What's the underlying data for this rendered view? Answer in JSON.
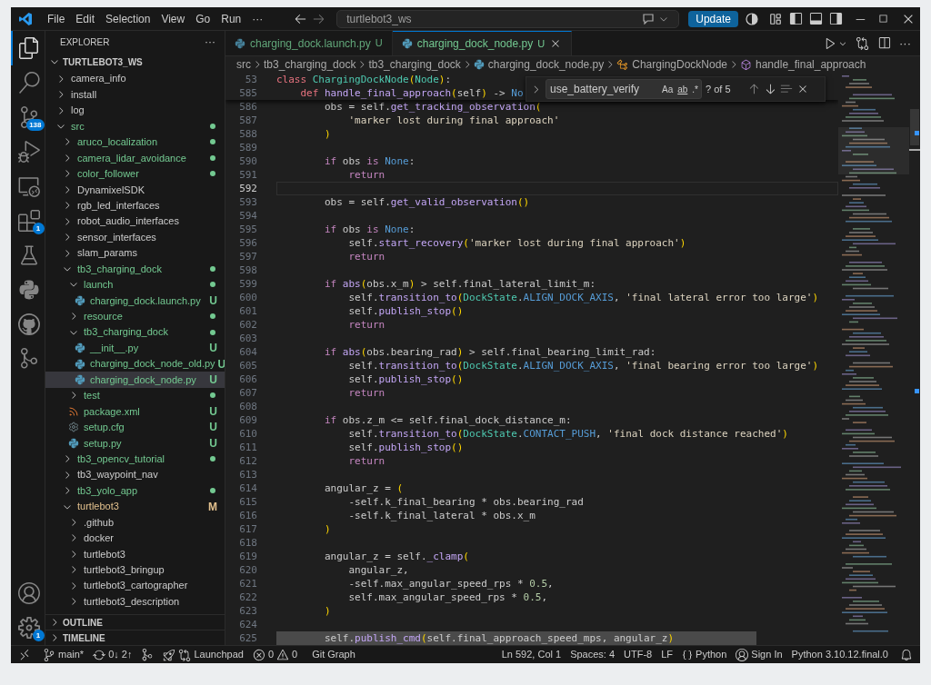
{
  "title_bar": {
    "menus": [
      "File",
      "Edit",
      "Selection",
      "View",
      "Go",
      "Run",
      "···"
    ],
    "command_center": "turtlebot3_ws",
    "update_button": "Update"
  },
  "activity_bar": {
    "items": [
      {
        "kind": "explorer",
        "selected": true
      },
      {
        "kind": "search",
        "selected": false
      },
      {
        "kind": "source_control",
        "selected": false,
        "badge": "138"
      },
      {
        "kind": "run_debug",
        "selected": false
      },
      {
        "kind": "remote",
        "selected": false
      },
      {
        "kind": "extensions",
        "selected": false,
        "badge": "1"
      },
      {
        "kind": "testing",
        "selected": false
      },
      {
        "kind": "python",
        "selected": false
      },
      {
        "kind": "github",
        "selected": false
      },
      {
        "kind": "git_graph",
        "selected": false
      }
    ],
    "bottom": [
      {
        "kind": "accounts"
      },
      {
        "kind": "settings",
        "badge": "1"
      }
    ]
  },
  "sidebar": {
    "title": "EXPLORER",
    "more": "···",
    "workspace": "TURTLEBOT3_WS",
    "tree": [
      {
        "label": "camera_info",
        "kind": "folder",
        "expanded": false,
        "color": "#cccccc",
        "dot": false,
        "selected": false
      },
      {
        "label": "install",
        "kind": "folder",
        "expanded": false,
        "color": "#cccccc",
        "dot": false,
        "selected": false
      },
      {
        "label": "log",
        "kind": "folder",
        "expanded": false,
        "color": "#cccccc",
        "dot": false,
        "selected": false
      },
      {
        "label": "src",
        "kind": "folder",
        "expanded": true,
        "color": "#73c991",
        "dot": true,
        "selected": false,
        "children": [
          {
            "label": "aruco_localization",
            "kind": "folder",
            "expanded": false,
            "color": "#73c991",
            "dot": true,
            "selected": false
          },
          {
            "label": "camera_lidar_avoidance",
            "kind": "folder",
            "expanded": false,
            "color": "#73c991",
            "dot": true,
            "selected": false
          },
          {
            "label": "color_follower",
            "kind": "folder",
            "expanded": false,
            "color": "#73c991",
            "dot": true,
            "selected": false
          },
          {
            "label": "DynamixelSDK",
            "kind": "folder",
            "expanded": false,
            "color": "#cccccc",
            "dot": false,
            "selected": false
          },
          {
            "label": "rgb_led_interfaces",
            "kind": "folder",
            "expanded": false,
            "color": "#cccccc",
            "dot": false,
            "selected": false
          },
          {
            "label": "robot_audio_interfaces",
            "kind": "folder",
            "expanded": false,
            "color": "#cccccc",
            "dot": false,
            "selected": false
          },
          {
            "label": "sensor_interfaces",
            "kind": "folder",
            "expanded": false,
            "color": "#cccccc",
            "dot": false,
            "selected": false
          },
          {
            "label": "slam_params",
            "kind": "folder",
            "expanded": false,
            "color": "#cccccc",
            "dot": false,
            "selected": false
          },
          {
            "label": "tb3_charging_dock",
            "kind": "folder",
            "expanded": true,
            "color": "#73c991",
            "dot": true,
            "selected": false,
            "children": [
              {
                "label": "launch",
                "kind": "folder",
                "expanded": true,
                "color": "#73c991",
                "dot": true,
                "selected": false,
                "children": [
                  {
                    "label": "charging_dock.launch.py",
                    "kind": "python",
                    "color": "#73c991",
                    "badge": "U",
                    "dot": false,
                    "selected": false
                  }
                ]
              },
              {
                "label": "resource",
                "kind": "folder",
                "expanded": false,
                "color": "#73c991",
                "dot": true,
                "selected": false
              },
              {
                "label": "tb3_charging_dock",
                "kind": "folder",
                "expanded": true,
                "color": "#73c991",
                "dot": true,
                "selected": false,
                "children": [
                  {
                    "label": "__init__.py",
                    "kind": "python",
                    "color": "#73c991",
                    "badge": "U",
                    "dot": false,
                    "selected": false
                  },
                  {
                    "label": "charging_dock_node_old.py",
                    "kind": "python",
                    "color": "#73c991",
                    "badge": "U",
                    "dot": false,
                    "selected": false
                  },
                  {
                    "label": "charging_dock_node.py",
                    "kind": "python",
                    "color": "#73c991",
                    "badge": "U",
                    "dot": false,
                    "selected": true
                  }
                ]
              },
              {
                "label": "test",
                "kind": "folder",
                "expanded": false,
                "color": "#73c991",
                "dot": true,
                "selected": false
              },
              {
                "label": "package.xml",
                "kind": "xml",
                "color": "#73c991",
                "badge": "U",
                "dot": false,
                "selected": false
              },
              {
                "label": "setup.cfg",
                "kind": "config",
                "color": "#73c991",
                "badge": "U",
                "dot": false,
                "selected": false
              },
              {
                "label": "setup.py",
                "kind": "python",
                "color": "#73c991",
                "badge": "U",
                "dot": false,
                "selected": false
              }
            ]
          },
          {
            "label": "tb3_opencv_tutorial",
            "kind": "folder",
            "expanded": false,
            "color": "#73c991",
            "dot": true,
            "selected": false
          },
          {
            "label": "tb3_waypoint_nav",
            "kind": "folder",
            "expanded": false,
            "color": "#cccccc",
            "dot": false,
            "selected": false
          },
          {
            "label": "tb3_yolo_app",
            "kind": "folder",
            "expanded": false,
            "color": "#73c991",
            "dot": true,
            "selected": false
          },
          {
            "label": "turtlebot3",
            "kind": "folder",
            "expanded": true,
            "color": "#e2c08d",
            "badge": "M",
            "dot": false,
            "selected": false,
            "children": [
              {
                "label": ".github",
                "kind": "folder",
                "expanded": false,
                "color": "#cccccc",
                "dot": false,
                "selected": false
              },
              {
                "label": "docker",
                "kind": "folder",
                "expanded": false,
                "color": "#cccccc",
                "dot": false,
                "selected": false
              },
              {
                "label": "turtlebot3",
                "kind": "folder",
                "expanded": false,
                "color": "#cccccc",
                "dot": false,
                "selected": false
              },
              {
                "label": "turtlebot3_bringup",
                "kind": "folder",
                "expanded": false,
                "color": "#cccccc",
                "dot": false,
                "selected": false
              },
              {
                "label": "turtlebot3_cartographer",
                "kind": "folder",
                "expanded": false,
                "color": "#cccccc",
                "dot": false,
                "selected": false
              },
              {
                "label": "turtlebot3_description",
                "kind": "folder",
                "expanded": false,
                "color": "#cccccc",
                "dot": false,
                "selected": false
              }
            ]
          }
        ]
      }
    ],
    "sections": [
      "OUTLINE",
      "TIMELINE"
    ]
  },
  "editor": {
    "tabs": [
      {
        "label": "charging_dock.launch.py",
        "badge": "U",
        "selected": false
      },
      {
        "label": "charging_dock_node.py",
        "badge": "U",
        "selected": true
      }
    ],
    "more": "···",
    "breadcrumbs": [
      {
        "kind": "folder",
        "label": "src"
      },
      {
        "kind": "folder",
        "label": "tb3_charging_dock"
      },
      {
        "kind": "folder",
        "label": "tb3_charging_dock"
      },
      {
        "kind": "python",
        "label": "charging_dock_node.py"
      },
      {
        "kind": "class",
        "label": "ChargingDockNode"
      },
      {
        "kind": "method",
        "label": "handle_final_approach"
      }
    ],
    "find": {
      "value": "use_battery_verify",
      "toggles": [
        "Aa",
        "ab",
        ".*"
      ],
      "result": "? of 5"
    },
    "sticky_lines": [
      {
        "number": "53",
        "tokens": [
          {
            "kind": "keyword",
            "text": "class "
          },
          {
            "kind": "class",
            "text": "ChargingDockNode"
          },
          {
            "kind": "bracket",
            "text": "("
          },
          {
            "kind": "class",
            "text": "Node"
          },
          {
            "kind": "bracket",
            "text": ")"
          },
          {
            "kind": "plain",
            "text": ":"
          }
        ]
      },
      {
        "number": "585",
        "tokens": [
          {
            "kind": "keyword",
            "text": "    def "
          },
          {
            "kind": "function",
            "text": "handle_final_approach"
          },
          {
            "kind": "bracket",
            "text": "("
          },
          {
            "kind": "plain",
            "text": "self"
          },
          {
            "kind": "bracket",
            "text": ")"
          },
          {
            "kind": "plain",
            "text": " -> "
          },
          {
            "kind": "constant",
            "text": "No"
          }
        ]
      }
    ],
    "lines": [
      {
        "number": "586",
        "current": false,
        "selected": false,
        "tokens": [
          {
            "kind": "plain",
            "text": "        obs = self."
          },
          {
            "kind": "function",
            "text": "get_tracking_observation"
          },
          {
            "kind": "bracket",
            "text": "("
          }
        ]
      },
      {
        "number": "587",
        "current": false,
        "selected": false,
        "tokens": [
          {
            "kind": "string",
            "text": "            'marker lost during final approach'"
          }
        ]
      },
      {
        "number": "588",
        "current": false,
        "selected": false,
        "tokens": [
          {
            "kind": "bracket",
            "text": "        )"
          }
        ]
      },
      {
        "number": "589",
        "current": false,
        "selected": false
      },
      {
        "number": "590",
        "current": false,
        "selected": false,
        "tokens": [
          {
            "kind": "control",
            "text": "        if"
          },
          {
            "kind": "plain",
            "text": " obs "
          },
          {
            "kind": "control",
            "text": "is"
          },
          {
            "kind": "constant",
            "text": " None"
          },
          {
            "kind": "plain",
            "text": ":"
          }
        ]
      },
      {
        "number": "591",
        "current": false,
        "selected": false,
        "tokens": [
          {
            "kind": "control",
            "text": "            return"
          }
        ]
      },
      {
        "number": "592",
        "current": true,
        "selected": false
      },
      {
        "number": "593",
        "current": false,
        "selected": false,
        "tokens": [
          {
            "kind": "plain",
            "text": "        obs = self."
          },
          {
            "kind": "function",
            "text": "get_valid_observation"
          },
          {
            "kind": "bracket",
            "text": "()"
          }
        ]
      },
      {
        "number": "594",
        "current": false,
        "selected": false
      },
      {
        "number": "595",
        "current": false,
        "selected": false,
        "tokens": [
          {
            "kind": "control",
            "text": "        if"
          },
          {
            "kind": "plain",
            "text": " obs "
          },
          {
            "kind": "control",
            "text": "is"
          },
          {
            "kind": "constant",
            "text": " None"
          },
          {
            "kind": "plain",
            "text": ":"
          }
        ]
      },
      {
        "number": "596",
        "current": false,
        "selected": false,
        "tokens": [
          {
            "kind": "plain",
            "text": "            self."
          },
          {
            "kind": "function",
            "text": "start_recovery"
          },
          {
            "kind": "bracket",
            "text": "("
          },
          {
            "kind": "string",
            "text": "'marker lost during final approach'"
          },
          {
            "kind": "bracket",
            "text": ")"
          }
        ]
      },
      {
        "number": "597",
        "current": false,
        "selected": false,
        "tokens": [
          {
            "kind": "control",
            "text": "            return"
          }
        ]
      },
      {
        "number": "598",
        "current": false,
        "selected": false
      },
      {
        "number": "599",
        "current": false,
        "selected": false,
        "tokens": [
          {
            "kind": "control",
            "text": "        if "
          },
          {
            "kind": "function",
            "text": "abs"
          },
          {
            "kind": "bracket",
            "text": "("
          },
          {
            "kind": "plain",
            "text": "obs.x_m"
          },
          {
            "kind": "bracket",
            "text": ")"
          },
          {
            "kind": "plain",
            "text": " > self.final_lateral_limit_m:"
          }
        ]
      },
      {
        "number": "600",
        "current": false,
        "selected": false,
        "tokens": [
          {
            "kind": "plain",
            "text": "            self."
          },
          {
            "kind": "function",
            "text": "transition_to"
          },
          {
            "kind": "bracket",
            "text": "("
          },
          {
            "kind": "class",
            "text": "DockState"
          },
          {
            "kind": "plain",
            "text": "."
          },
          {
            "kind": "constant",
            "text": "ALIGN_DOCK_AXIS"
          },
          {
            "kind": "plain",
            "text": ", "
          },
          {
            "kind": "string",
            "text": "'final lateral error too large'"
          },
          {
            "kind": "bracket",
            "text": ")"
          }
        ]
      },
      {
        "number": "601",
        "current": false,
        "selected": false,
        "tokens": [
          {
            "kind": "plain",
            "text": "            self."
          },
          {
            "kind": "function",
            "text": "publish_stop"
          },
          {
            "kind": "bracket",
            "text": "()"
          }
        ]
      },
      {
        "number": "602",
        "current": false,
        "selected": false,
        "tokens": [
          {
            "kind": "control",
            "text": "            return"
          }
        ]
      },
      {
        "number": "603",
        "current": false,
        "selected": false
      },
      {
        "number": "604",
        "current": false,
        "selected": false,
        "tokens": [
          {
            "kind": "control",
            "text": "        if "
          },
          {
            "kind": "function",
            "text": "abs"
          },
          {
            "kind": "bracket",
            "text": "("
          },
          {
            "kind": "plain",
            "text": "obs.bearing_rad"
          },
          {
            "kind": "bracket",
            "text": ")"
          },
          {
            "kind": "plain",
            "text": " > self.final_bearing_limit_rad:"
          }
        ]
      },
      {
        "number": "605",
        "current": false,
        "selected": false,
        "tokens": [
          {
            "kind": "plain",
            "text": "            self."
          },
          {
            "kind": "function",
            "text": "transition_to"
          },
          {
            "kind": "bracket",
            "text": "("
          },
          {
            "kind": "class",
            "text": "DockState"
          },
          {
            "kind": "plain",
            "text": "."
          },
          {
            "kind": "constant",
            "text": "ALIGN_DOCK_AXIS"
          },
          {
            "kind": "plain",
            "text": ", "
          },
          {
            "kind": "string",
            "text": "'final bearing error too large'"
          },
          {
            "kind": "bracket",
            "text": ")"
          }
        ]
      },
      {
        "number": "606",
        "current": false,
        "selected": false,
        "tokens": [
          {
            "kind": "plain",
            "text": "            self."
          },
          {
            "kind": "function",
            "text": "publish_stop"
          },
          {
            "kind": "bracket",
            "text": "()"
          }
        ]
      },
      {
        "number": "607",
        "current": false,
        "selected": false,
        "tokens": [
          {
            "kind": "control",
            "text": "            return"
          }
        ]
      },
      {
        "number": "608",
        "current": false,
        "selected": false
      },
      {
        "number": "609",
        "current": false,
        "selected": false,
        "tokens": [
          {
            "kind": "control",
            "text": "        if"
          },
          {
            "kind": "plain",
            "text": " obs.z_m <= self.final_dock_distance_m:"
          }
        ]
      },
      {
        "number": "610",
        "current": false,
        "selected": false,
        "tokens": [
          {
            "kind": "plain",
            "text": "            self."
          },
          {
            "kind": "function",
            "text": "transition_to"
          },
          {
            "kind": "bracket",
            "text": "("
          },
          {
            "kind": "class",
            "text": "DockState"
          },
          {
            "kind": "plain",
            "text": "."
          },
          {
            "kind": "constant",
            "text": "CONTACT_PUSH"
          },
          {
            "kind": "plain",
            "text": ", "
          },
          {
            "kind": "string",
            "text": "'final dock distance reached'"
          },
          {
            "kind": "bracket",
            "text": ")"
          }
        ]
      },
      {
        "number": "611",
        "current": false,
        "selected": false,
        "tokens": [
          {
            "kind": "plain",
            "text": "            self."
          },
          {
            "kind": "function",
            "text": "publish_stop"
          },
          {
            "kind": "bracket",
            "text": "()"
          }
        ]
      },
      {
        "number": "612",
        "current": false,
        "selected": false,
        "tokens": [
          {
            "kind": "control",
            "text": "            return"
          }
        ]
      },
      {
        "number": "613",
        "current": false,
        "selected": false
      },
      {
        "number": "614",
        "current": false,
        "selected": false,
        "tokens": [
          {
            "kind": "plain",
            "text": "        angular_z = "
          },
          {
            "kind": "bracket",
            "text": "("
          }
        ]
      },
      {
        "number": "615",
        "current": false,
        "selected": false,
        "tokens": [
          {
            "kind": "plain",
            "text": "            -self.k_final_bearing * obs.bearing_rad"
          }
        ]
      },
      {
        "number": "616",
        "current": false,
        "selected": false,
        "tokens": [
          {
            "kind": "plain",
            "text": "            -self.k_final_lateral * obs.x_m"
          }
        ]
      },
      {
        "number": "617",
        "current": false,
        "selected": false,
        "tokens": [
          {
            "kind": "bracket",
            "text": "        )"
          }
        ]
      },
      {
        "number": "618",
        "current": false,
        "selected": false
      },
      {
        "number": "619",
        "current": false,
        "selected": false,
        "tokens": [
          {
            "kind": "plain",
            "text": "        angular_z = self."
          },
          {
            "kind": "function",
            "text": "_clamp"
          },
          {
            "kind": "bracket",
            "text": "("
          }
        ]
      },
      {
        "number": "620",
        "current": false,
        "selected": false,
        "tokens": [
          {
            "kind": "plain",
            "text": "            angular_z,"
          }
        ]
      },
      {
        "number": "621",
        "current": false,
        "selected": false,
        "tokens": [
          {
            "kind": "plain",
            "text": "            -self.max_angular_speed_rps * "
          },
          {
            "kind": "number",
            "text": "0.5"
          },
          {
            "kind": "plain",
            "text": ","
          }
        ]
      },
      {
        "number": "622",
        "current": false,
        "selected": false,
        "tokens": [
          {
            "kind": "plain",
            "text": "            self.max_angular_speed_rps * "
          },
          {
            "kind": "number",
            "text": "0.5"
          },
          {
            "kind": "plain",
            "text": ","
          }
        ]
      },
      {
        "number": "623",
        "current": false,
        "selected": false,
        "tokens": [
          {
            "kind": "bracket",
            "text": "        )"
          }
        ]
      },
      {
        "number": "624",
        "current": false,
        "selected": false
      },
      {
        "number": "625",
        "current": false,
        "selected": true,
        "tokens": [
          {
            "kind": "plain",
            "text": "        self."
          },
          {
            "kind": "function",
            "text": "publish_cmd"
          },
          {
            "kind": "bracket",
            "text": "("
          },
          {
            "kind": "plain",
            "text": "self.final_approach_speed_mps, angular_z"
          },
          {
            "kind": "bracket",
            "text": ")"
          }
        ]
      }
    ]
  },
  "status_bar": {
    "branch": "main*",
    "sync": "0↓ 2↑",
    "launchpad": "Launchpad",
    "errors": "0",
    "warnings": "0",
    "git_graph": "Git Graph",
    "position": "Ln 592, Col 1",
    "spaces": "Spaces: 4",
    "encoding": "UTF-8",
    "eol": "LF",
    "language": "Python",
    "sign_in": "Sign In",
    "interpreter": "Python 3.10.12.final.0"
  }
}
